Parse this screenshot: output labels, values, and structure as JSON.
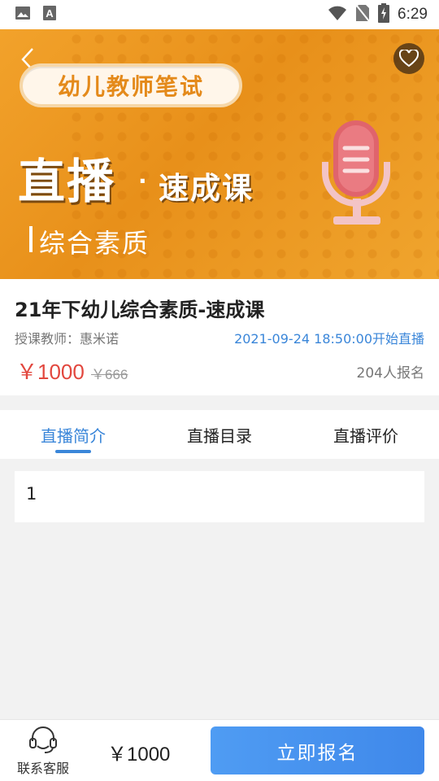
{
  "status_bar": {
    "time": "6:29",
    "left_icons": [
      "image-icon",
      "a-icon"
    ],
    "right_icons": [
      "wifi-icon",
      "no-sim-icon",
      "battery-charging-icon"
    ]
  },
  "banner": {
    "pill_text": "幼儿教师笔试",
    "live_title": "直播",
    "dot": "·",
    "live_subtitle": "速成课",
    "subject": "综合素质",
    "colors": {
      "orange": "#e8901a",
      "white": "#ffffff"
    }
  },
  "course": {
    "title": "21年下幼儿综合素质-速成课",
    "teacher": "授课教师：惠米诺",
    "start_time": "2021-09-24 18:50:00开始直播",
    "price": "￥1000",
    "original_price": "￥666",
    "enrolled": "204人报名"
  },
  "tabs": [
    {
      "label": "直播简介",
      "active": true
    },
    {
      "label": "直播目录",
      "active": false
    },
    {
      "label": "直播评价",
      "active": false
    }
  ],
  "content": {
    "text": "1"
  },
  "bottom": {
    "service_label": "联系客服",
    "price": "￥1000",
    "enroll_label": "立即报名"
  },
  "colors": {
    "accent_blue": "#3a86d9",
    "price_red": "#e2473e"
  }
}
